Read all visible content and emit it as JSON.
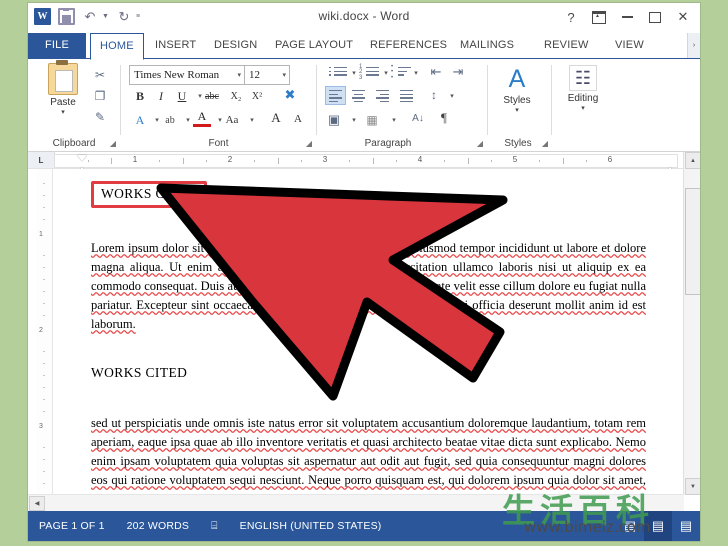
{
  "window": {
    "title": "wiki.docx - Word",
    "quick_access": [
      {
        "name": "word-logo",
        "label": "W"
      },
      {
        "name": "save",
        "label": "Save"
      },
      {
        "name": "undo",
        "label": "Undo"
      },
      {
        "name": "redo",
        "label": "Redo"
      },
      {
        "name": "customize-qat",
        "label": "‹"
      }
    ],
    "controls": [
      {
        "name": "help",
        "glyph": "?"
      },
      {
        "name": "ribbon-display-options",
        "glyph": ""
      },
      {
        "name": "minimize",
        "glyph": ""
      },
      {
        "name": "maximize",
        "glyph": ""
      },
      {
        "name": "close",
        "glyph": "✕"
      }
    ]
  },
  "tabs": [
    {
      "label": "FILE",
      "active": false
    },
    {
      "label": "HOME",
      "active": true
    },
    {
      "label": "INSERT",
      "active": false
    },
    {
      "label": "DESIGN",
      "active": false
    },
    {
      "label": "PAGE LAYOUT",
      "active": false
    },
    {
      "label": "REFERENCES",
      "active": false
    },
    {
      "label": "MAILINGS",
      "active": false
    },
    {
      "label": "REVIEW",
      "active": false
    },
    {
      "label": "VIEW",
      "active": false
    }
  ],
  "tab_overflow": "›",
  "ribbon": {
    "groups": [
      {
        "name": "clipboard",
        "label": "Clipboard"
      },
      {
        "name": "font",
        "label": "Font"
      },
      {
        "name": "paragraph",
        "label": "Paragraph"
      },
      {
        "name": "styles",
        "label": "Styles"
      },
      {
        "name": "editing",
        "label": ""
      }
    ],
    "clipboard": {
      "paste_label": "Paste",
      "paste_caret": "▾",
      "cut_label": "✂",
      "copy_label": "❐",
      "format_painter_label": "✎"
    },
    "font": {
      "font_name": "Times New Roman",
      "font_size": "12",
      "caret": "▾",
      "bold": "B",
      "italic": "I",
      "underline": "U",
      "underline_caret": "▾",
      "strikethrough": "abc",
      "subscript": "X₂",
      "superscript": "X²",
      "clear_formatting": "✗",
      "text_effects": "A",
      "highlight": "ab",
      "font_color": "A",
      "change_case": "Aa",
      "grow_font": "A",
      "shrink_font": "A",
      "dialog_launcher": "❱"
    },
    "paragraph": {
      "bullets": "☰",
      "numbering": "☰",
      "multilevel": "☰",
      "decrease_indent": "←",
      "increase_indent": "→",
      "line_spacing": "↕",
      "align_left": "",
      "align_center": "",
      "align_right": "",
      "justify": "",
      "shading": "▣",
      "borders": "▦",
      "sort": "A↓",
      "show_marks": "¶",
      "dialog_launcher": "❱"
    },
    "styles": {
      "label": "Styles",
      "caret": "▾",
      "glyph": "A",
      "dialog_launcher": "❱"
    },
    "editing": {
      "label": "Editing",
      "caret": "▾",
      "glyph": "☍"
    }
  },
  "ruler": {
    "corner_marker": "L",
    "numbers": [
      "1",
      "2",
      "3",
      "4",
      "5",
      "6"
    ],
    "vertical_numbers": [
      "1",
      "2",
      "3"
    ]
  },
  "document": {
    "heading1": "WORKS CITED",
    "heading1_selected": true,
    "paragraph1": "Lorem ipsum dolor sit amet, consectetur adipiscing elit, sed do eiusmod tempor incididunt ut labore et dolore magna aliqua. Ut enim ad minim veniam, quis nostrud exercitation ullamco laboris nisi ut aliquip ex ea commodo consequat. Duis aute irure dolor in reprehenderit in voluptate velit esse cillum dolore eu fugiat nulla pariatur. Excepteur sint occaecat cupidatat non proident, sunt in culpa qui officia deserunt mollit anim id est laborum.",
    "heading2": "WORKS CITED",
    "paragraph2": "sed ut perspiciatis unde omnis iste natus error sit voluptatem accusantium doloremque laudantium, totam rem aperiam, eaque ipsa quae ab illo inventore veritatis et quasi architecto beatae vitae dicta sunt explicabo. Nemo enim ipsam voluptatem quia voluptas sit aspernatur aut odit aut fugit, sed quia consequuntur magni dolores eos qui ratione voluptatem sequi nesciunt. Neque porro quisquam est, qui dolorem ipsum quia dolor sit amet, consectetur"
  },
  "statusbar": {
    "page": "PAGE 1 OF 1",
    "words": "202 WORDS",
    "proofing_icon": "⌸",
    "language": "ENGLISH (UNITED STATES)",
    "views": [
      {
        "name": "read-mode",
        "glyph": "▤",
        "active": false
      },
      {
        "name": "print-layout",
        "glyph": "▤",
        "active": true
      },
      {
        "name": "web-layout",
        "glyph": "▤",
        "active": false
      }
    ]
  },
  "watermark": {
    "chinese": "生活百科",
    "url": "www.bimeiz.com"
  },
  "annotation": {
    "cursor_color": "#d8353d",
    "highlight_color": "#e03c41"
  },
  "colors": {
    "background": "#b5cf9b",
    "accent": "#2b579a"
  }
}
